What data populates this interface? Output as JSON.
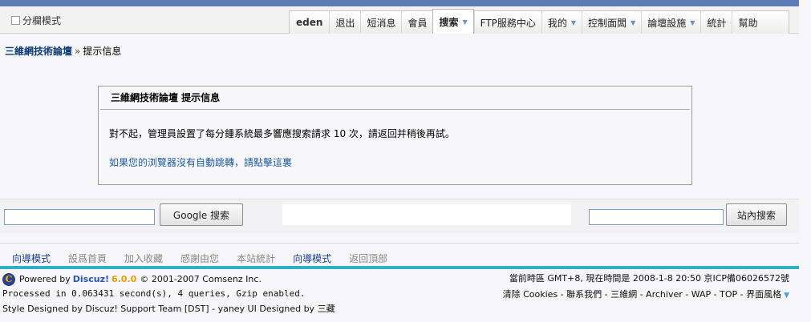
{
  "toolbar": {
    "split_mode_label": "分欄模式",
    "username": "eden",
    "items": [
      {
        "label": "退出",
        "dropdown": false
      },
      {
        "label": "短消息",
        "dropdown": false
      },
      {
        "label": "會員",
        "dropdown": false
      },
      {
        "label": "搜索",
        "dropdown": true,
        "active": true
      },
      {
        "label": "FTP服務中心",
        "dropdown": false
      },
      {
        "label": "我的",
        "dropdown": true
      },
      {
        "label": "控制面闆",
        "dropdown": true
      },
      {
        "label": "論壇設施",
        "dropdown": true
      },
      {
        "label": "統計",
        "dropdown": false
      },
      {
        "label": "幫助",
        "dropdown": false
      }
    ]
  },
  "breadcrumb": {
    "home": "三維網技術論壇",
    "separator": "»",
    "current": "提示信息"
  },
  "message": {
    "title": "三維網技術論壇  提示信息",
    "text": "對不起，管理員設置了每分鍾系統最多響應搜索請求  10 次，請返回并稍後再試。",
    "redirect_link": "如果您的浏覽器沒有自動跳轉，請點擊這裏"
  },
  "search": {
    "google_button": "Google 搜索",
    "site_button": "站內搜索",
    "google_input_value": "",
    "site_input_value": ""
  },
  "footer_nav": [
    {
      "label": "向導模式",
      "active": true
    },
    {
      "label": "設爲首頁",
      "active": false
    },
    {
      "label": "加入收藏",
      "active": false
    },
    {
      "label": "感謝由您",
      "active": false
    },
    {
      "label": "本站統計",
      "active": false
    },
    {
      "label": "向導模式",
      "active": true
    },
    {
      "label": "返回頂部",
      "active": false
    }
  ],
  "footer": {
    "powered_prefix": "Powered by",
    "brand": "Discuz!",
    "version": "6.0.0",
    "copyright": "© 2001-2007 Comsenz Inc.",
    "processed": "Processed in 0.063431 second(s), 4 queries, Gzip enabled.",
    "style_credit": "Style Designed by Discuz! Support Team [DST] - yaney UI Designed by 三藏",
    "time_info": "當前時區  GMT+8, 現在時間是  2008-1-8 20:50 京ICP備06026572號",
    "links": "清除  Cookies - 聯系我們 - 三維網 - Archiver - WAP - TOP - 界面風格"
  },
  "colors": {
    "top_strip": "#5c7ab3",
    "link_dark": "#0b3a75",
    "link_blue": "#1e5b9c",
    "teal_bar": "#2fb0c5",
    "discuz_version": "#e5a100"
  }
}
